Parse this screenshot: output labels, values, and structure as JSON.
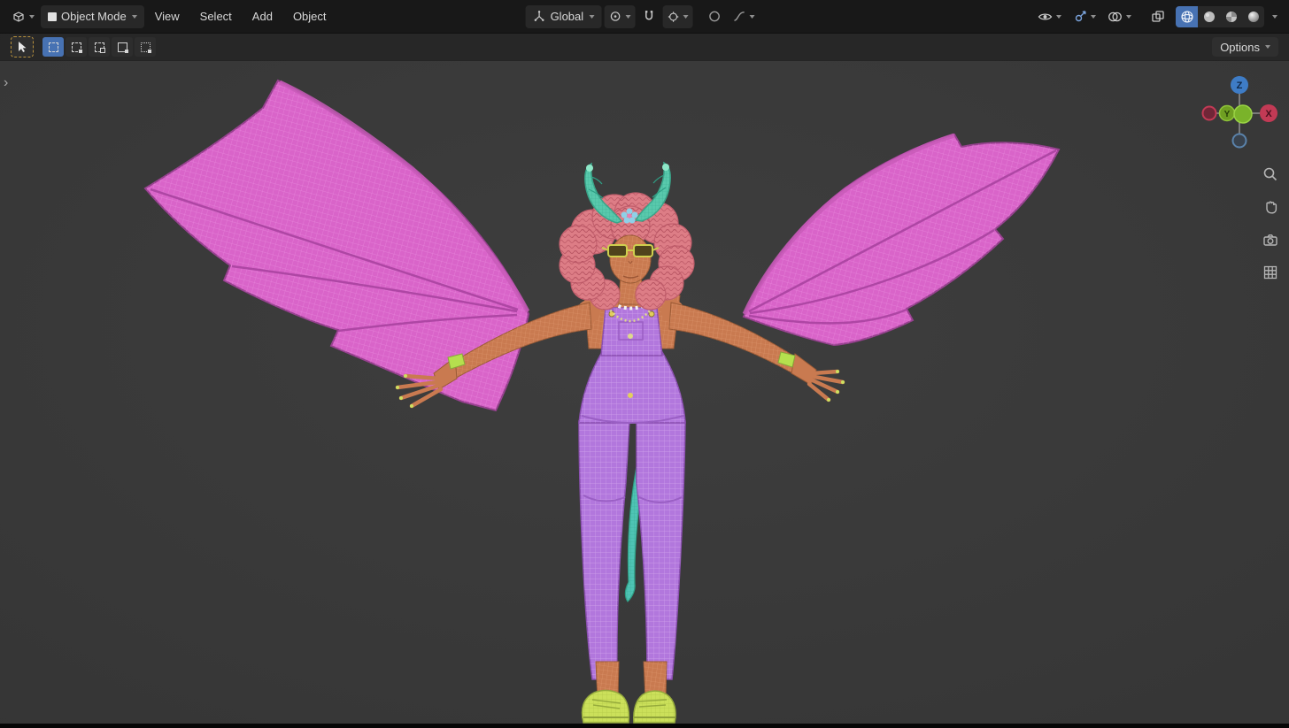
{
  "header": {
    "editor_type": {
      "icon": "3d-viewport-editor-icon"
    },
    "mode_dropdown": {
      "icon": "object-mode-icon",
      "value": "Object Mode"
    },
    "menus": [
      {
        "label": "View"
      },
      {
        "label": "Select"
      },
      {
        "label": "Add"
      },
      {
        "label": "Object"
      }
    ],
    "transform_orientation": {
      "icon": "orientation-axes-icon",
      "value": "Global"
    },
    "pivot_point": {
      "icon": "pivot-point-icon"
    },
    "snapping": {
      "toggle_icon": "magnet-icon",
      "target_icon": "snap-target-icon"
    },
    "proportional_editing": {
      "toggle_icon": "proportional-circle-icon",
      "falloff_icon": "falloff-curve-icon"
    },
    "view_object_types": {
      "icon": "visibility-eye-icon"
    },
    "gizmos": {
      "icon": "gizmo-arrows-icon",
      "enabled": true
    },
    "overlays": {
      "icon": "overlays-circles-icon",
      "enabled": true
    },
    "xray": {
      "icon": "xray-squares-icon",
      "enabled": false
    },
    "shading_modes": [
      {
        "name": "wireframe",
        "icon": "wireframe-sphere-icon",
        "active": true
      },
      {
        "name": "solid",
        "icon": "solid-sphere-icon",
        "active": false
      },
      {
        "name": "material-preview",
        "icon": "material-sphere-icon",
        "active": false
      },
      {
        "name": "rendered",
        "icon": "rendered-sphere-icon",
        "active": false
      }
    ]
  },
  "tool_header": {
    "active_tool": {
      "name": "tweak",
      "icon": "cursor-arrow-icon"
    },
    "select_tools": [
      {
        "name": "select-box-set",
        "active": true
      },
      {
        "name": "select-box-extend",
        "active": false
      },
      {
        "name": "select-box-subtract",
        "active": false
      },
      {
        "name": "select-box-invert",
        "active": false
      },
      {
        "name": "select-box-intersect",
        "active": false
      }
    ],
    "options": {
      "label": "Options"
    }
  },
  "viewport": {
    "toolbar_expand": "›",
    "nav_gizmo": {
      "z_label": "Z",
      "y_label": "Y",
      "x_label": "X"
    },
    "side_tools": [
      {
        "name": "zoom",
        "icon": "magnifier-icon"
      },
      {
        "name": "pan",
        "icon": "hand-icon"
      },
      {
        "name": "camera-view",
        "icon": "camera-icon"
      },
      {
        "name": "toggle-orthographic",
        "icon": "grid-icon"
      }
    ]
  },
  "colors": {
    "selection_accent": "#4772b3",
    "active_tool_outline": "#b8913d",
    "viewport_background": "#3a3a3a",
    "header_background": "#181818",
    "wing_magenta": "#d964c9",
    "hair_pink": "#dd7d86",
    "horn_teal": "#58c9ac",
    "skin_orange": "#c97a50",
    "overalls_purple": "#b277dd",
    "shoes_green": "#cbe05a",
    "axis_x_red": "#c23a55",
    "axis_y_green": "#7ab32a",
    "axis_z_blue": "#3e7cc6"
  }
}
